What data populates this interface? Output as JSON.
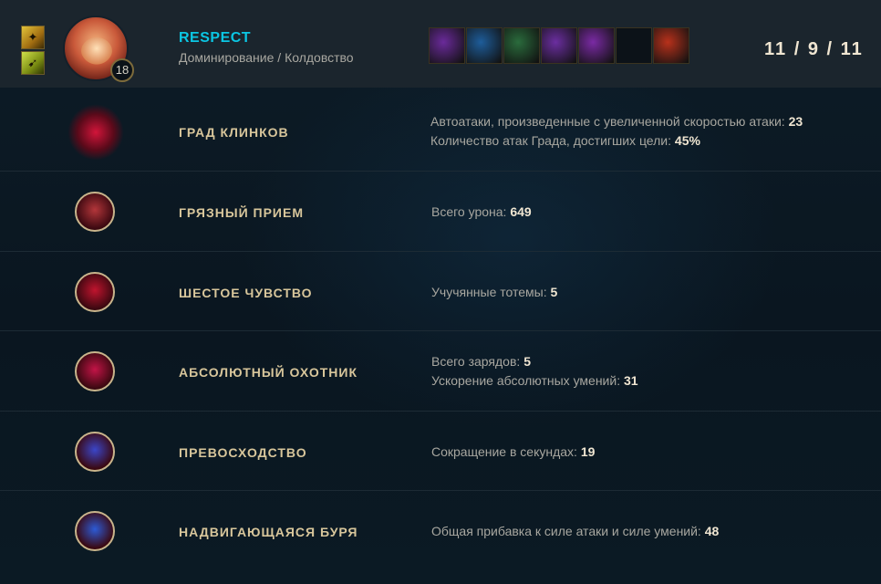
{
  "header": {
    "player_name": "RESPECT",
    "rune_paths": "Доминирование / Колдовство",
    "level": "18",
    "kda": "11 / 9 / 11",
    "champion_icon": "champion-portrait",
    "summoner_spells": [
      {
        "icon": "flash-icon",
        "color": "#e3c43a"
      },
      {
        "icon": "ghost-icon",
        "color": "#cfe04a"
      }
    ],
    "items": [
      {
        "icon": "item-1",
        "color": "#6a2a9a"
      },
      {
        "icon": "item-2",
        "color": "#1e5d9a"
      },
      {
        "icon": "item-3",
        "color": "#2a6b3c"
      },
      {
        "icon": "item-4",
        "color": "#6b2ea0"
      },
      {
        "icon": "item-5",
        "color": "#7a2aa4"
      },
      {
        "icon": "empty-slot",
        "color": "#0c1218"
      },
      {
        "icon": "trinket",
        "color": "#b8311b"
      }
    ]
  },
  "runes": [
    {
      "name": "ГРАД КЛИНКОВ",
      "color": "#d2153a",
      "stats": [
        {
          "label": "Автоатаки, произведенные с увеличенной скоростью атаки:",
          "value": "23"
        },
        {
          "label": "Количество атак Града, достигших цели:",
          "value": "45%"
        }
      ]
    },
    {
      "name": "ГРЯЗНЫЙ ПРИЕМ",
      "color": "#b3363a",
      "stats": [
        {
          "label": "Всего урона:",
          "value": "649"
        }
      ]
    },
    {
      "name": "ШЕСТОЕ ЧУВСТВО",
      "color": "#c0142e",
      "stats": [
        {
          "label": "Учучянные тотемы:",
          "value": "5"
        }
      ]
    },
    {
      "name": "АБСОЛЮТНЫЙ ОХОТНИК",
      "color": "#c21447",
      "stats": [
        {
          "label": "Всего зарядов:",
          "value": "5"
        },
        {
          "label": "Ускорение абсолютных умений:",
          "value": "31"
        }
      ]
    },
    {
      "name": "ПРЕВОСХОДСТВО",
      "color": "#3b46c9",
      "stats": [
        {
          "label": "Сокращение в секундах:",
          "value": "19"
        }
      ]
    },
    {
      "name": "НАДВИГАЮЩАЯСЯ БУРЯ",
      "color": "#2d5bd6",
      "stats": [
        {
          "label": "Общая прибавка к силе атаки и силе умений:",
          "value": "48"
        }
      ]
    }
  ]
}
